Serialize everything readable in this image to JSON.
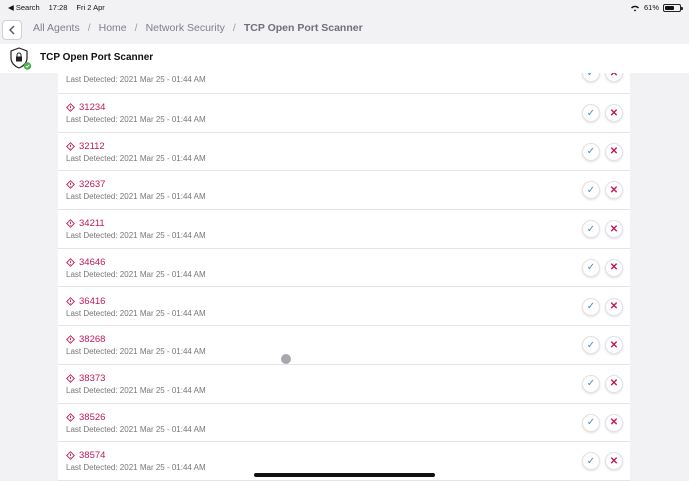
{
  "status": {
    "back_label": "◀ Search",
    "time": "17:28",
    "date": "Fri 2 Apr",
    "battery": "61%",
    "battery_level": 0.61
  },
  "breadcrumb": [
    "All Agents",
    "Home",
    "Network Security",
    "TCP Open Port Scanner"
  ],
  "header": {
    "title": "TCP Open Port Scanner"
  },
  "partial_row": {
    "detected": "Last Detected: 2021 Mar 25 - 01:44 AM"
  },
  "rows": [
    {
      "port": "31234",
      "detected": "Last Detected: 2021 Mar 25 - 01:44 AM"
    },
    {
      "port": "32112",
      "detected": "Last Detected: 2021 Mar 25 - 01:44 AM"
    },
    {
      "port": "32637",
      "detected": "Last Detected: 2021 Mar 25 - 01:44 AM"
    },
    {
      "port": "34211",
      "detected": "Last Detected: 2021 Mar 25 - 01:44 AM"
    },
    {
      "port": "34646",
      "detected": "Last Detected: 2021 Mar 25 - 01:44 AM"
    },
    {
      "port": "36416",
      "detected": "Last Detected: 2021 Mar 25 - 01:44 AM"
    },
    {
      "port": "38268",
      "detected": "Last Detected: 2021 Mar 25 - 01:44 AM"
    },
    {
      "port": "38373",
      "detected": "Last Detected: 2021 Mar 25 - 01:44 AM"
    },
    {
      "port": "38526",
      "detected": "Last Detected: 2021 Mar 25 - 01:44 AM"
    },
    {
      "port": "38574",
      "detected": "Last Detected: 2021 Mar 25 - 01:44 AM"
    }
  ],
  "icons": {
    "accept": "checkmark-icon",
    "dismiss": "x-icon",
    "port": "diamond-warning-icon",
    "header": "shield-lock-icon"
  },
  "colors": {
    "accent": "#c2185b",
    "check": "#3a8fd6",
    "badge": "#4caf50"
  }
}
